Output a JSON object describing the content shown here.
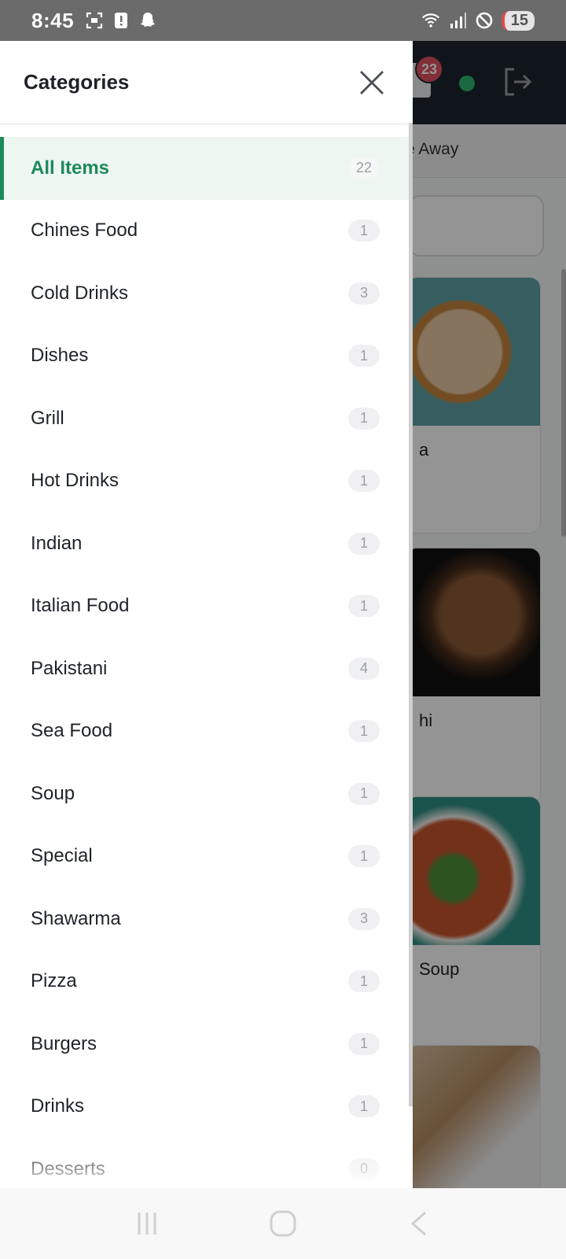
{
  "status_bar": {
    "time": "8:45",
    "battery": "15",
    "icons": [
      "screenshot-icon",
      "alert-icon",
      "snapchat-icon",
      "wifi-icon",
      "signal-icon",
      "do-not-disturb-icon"
    ]
  },
  "background_app": {
    "notification_count": "23",
    "tab_partial": "e Away",
    "cards": [
      {
        "name_partial": "a"
      },
      {
        "name_partial": "hi"
      },
      {
        "name_partial": "Soup"
      },
      {
        "name_partial": ""
      }
    ]
  },
  "drawer": {
    "title": "Categories",
    "categories": [
      {
        "label": "All Items",
        "count": "22",
        "active": true
      },
      {
        "label": "Chines Food",
        "count": "1"
      },
      {
        "label": "Cold Drinks",
        "count": "3"
      },
      {
        "label": "Dishes",
        "count": "1"
      },
      {
        "label": "Grill",
        "count": "1"
      },
      {
        "label": "Hot Drinks",
        "count": "1"
      },
      {
        "label": "Indian",
        "count": "1"
      },
      {
        "label": "Italian Food",
        "count": "1"
      },
      {
        "label": "Pakistani",
        "count": "4"
      },
      {
        "label": "Sea Food",
        "count": "1"
      },
      {
        "label": "Soup",
        "count": "1"
      },
      {
        "label": "Special",
        "count": "1"
      },
      {
        "label": "Shawarma",
        "count": "3"
      },
      {
        "label": "Pizza",
        "count": "1"
      },
      {
        "label": "Burgers",
        "count": "1"
      },
      {
        "label": "Drinks",
        "count": "1"
      },
      {
        "label": "Desserts",
        "count": "0"
      }
    ]
  },
  "colors": {
    "accent": "#1d8a5a",
    "active_bg": "#eef6f2",
    "topbar": "#1c2530",
    "badge": "#e05260",
    "online": "#2fb66e"
  }
}
